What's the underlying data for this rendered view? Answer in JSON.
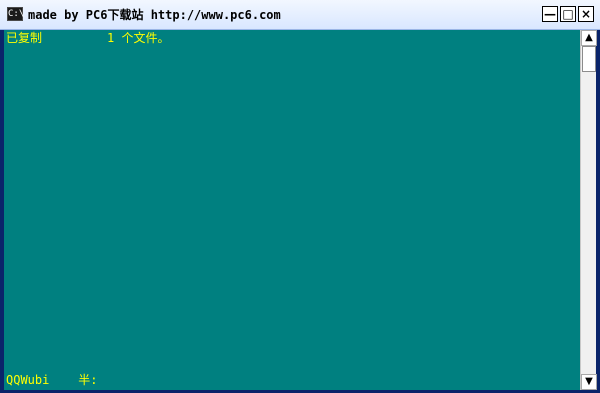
{
  "window": {
    "title": "made by PC6下载站 http://www.pc6.com",
    "icon_text": "C:\\",
    "buttons": {
      "minimize": "—",
      "maximize": "□",
      "close": "×"
    }
  },
  "console": {
    "line1": "已复制         1 个文件。",
    "status_line": "QQWubi    半:"
  },
  "scrollbar": {
    "up_arrow": "▲",
    "down_arrow": "▼"
  },
  "colors": {
    "console_bg": "#008080",
    "console_text": "#ffff00"
  }
}
